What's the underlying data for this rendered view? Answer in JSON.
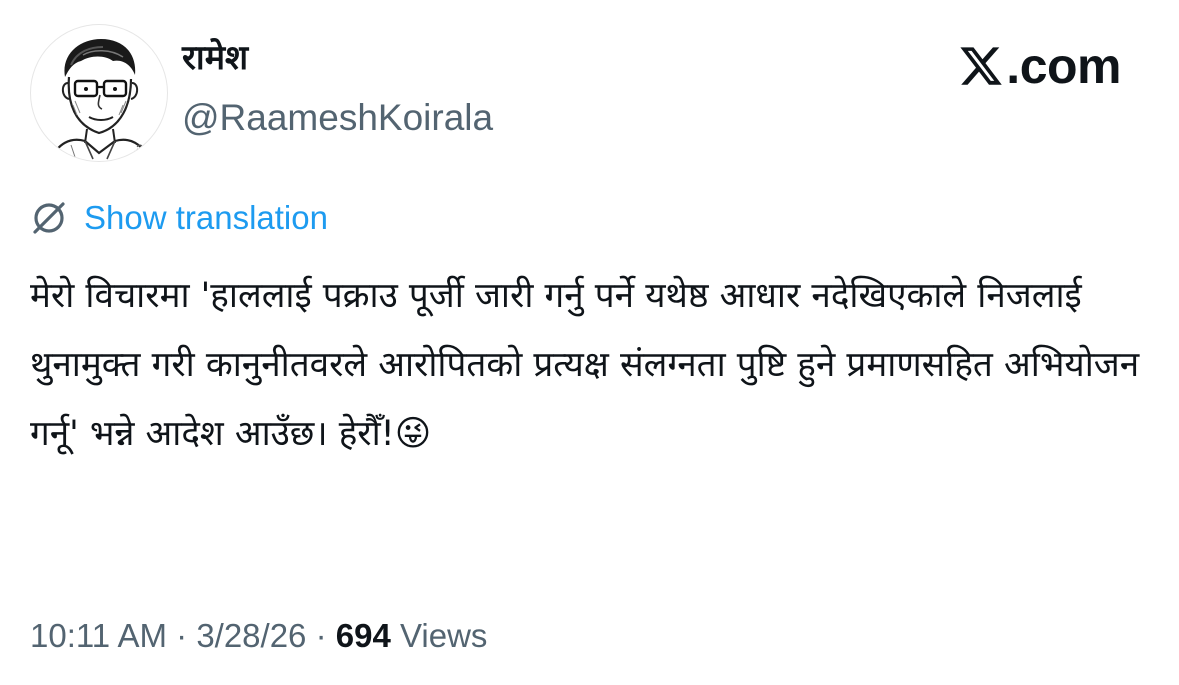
{
  "author": {
    "display_name": "रामेश",
    "handle": "@RaameshKoirala"
  },
  "brand": {
    "text": ".com",
    "icon": "x-logo-icon"
  },
  "translation": {
    "label": "Show translation",
    "icon": "globe-translate-icon",
    "color": "#1d9bf0"
  },
  "tweet": {
    "text": "मेरो विचारमा 'हाललाई पक्राउ पूर्जी जारी गर्नु पर्ने यथेष्ठ आधार नदेखिएकाले निजलाई थुनामुक्त गरी कानुनीतवरले आरोपितको प्रत्यक्ष संलग्नता पुष्टि हुने प्रमाणसहित अभियोजन गर्नू' भन्ने आदेश आउँछ। हेरौँ!😜"
  },
  "meta": {
    "time": "10:11 AM",
    "separator_1": " · ",
    "date": "3/28/26",
    "separator_2": " · ",
    "views_count": "694",
    "views_label": " Views"
  },
  "colors": {
    "text_primary": "#0f1419",
    "text_secondary": "#536471",
    "link": "#1d9bf0"
  }
}
